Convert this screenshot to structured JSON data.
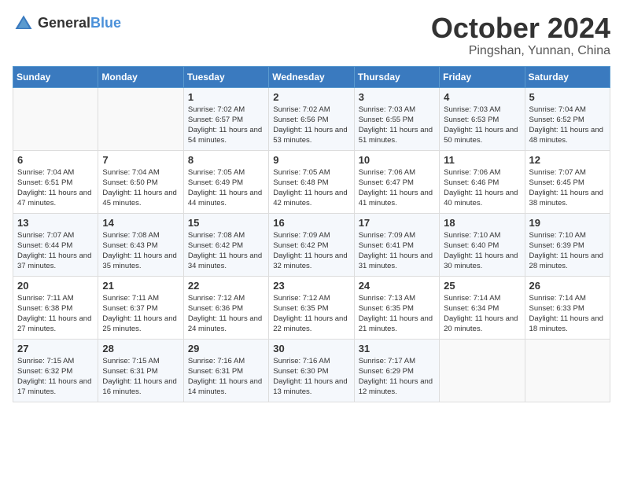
{
  "header": {
    "logo_general": "General",
    "logo_blue": "Blue",
    "month_title": "October 2024",
    "location": "Pingshan, Yunnan, China"
  },
  "weekdays": [
    "Sunday",
    "Monday",
    "Tuesday",
    "Wednesday",
    "Thursday",
    "Friday",
    "Saturday"
  ],
  "weeks": [
    [
      {
        "day": "",
        "sunrise": "",
        "sunset": "",
        "daylight": ""
      },
      {
        "day": "",
        "sunrise": "",
        "sunset": "",
        "daylight": ""
      },
      {
        "day": "1",
        "sunrise": "Sunrise: 7:02 AM",
        "sunset": "Sunset: 6:57 PM",
        "daylight": "Daylight: 11 hours and 54 minutes."
      },
      {
        "day": "2",
        "sunrise": "Sunrise: 7:02 AM",
        "sunset": "Sunset: 6:56 PM",
        "daylight": "Daylight: 11 hours and 53 minutes."
      },
      {
        "day": "3",
        "sunrise": "Sunrise: 7:03 AM",
        "sunset": "Sunset: 6:55 PM",
        "daylight": "Daylight: 11 hours and 51 minutes."
      },
      {
        "day": "4",
        "sunrise": "Sunrise: 7:03 AM",
        "sunset": "Sunset: 6:53 PM",
        "daylight": "Daylight: 11 hours and 50 minutes."
      },
      {
        "day": "5",
        "sunrise": "Sunrise: 7:04 AM",
        "sunset": "Sunset: 6:52 PM",
        "daylight": "Daylight: 11 hours and 48 minutes."
      }
    ],
    [
      {
        "day": "6",
        "sunrise": "Sunrise: 7:04 AM",
        "sunset": "Sunset: 6:51 PM",
        "daylight": "Daylight: 11 hours and 47 minutes."
      },
      {
        "day": "7",
        "sunrise": "Sunrise: 7:04 AM",
        "sunset": "Sunset: 6:50 PM",
        "daylight": "Daylight: 11 hours and 45 minutes."
      },
      {
        "day": "8",
        "sunrise": "Sunrise: 7:05 AM",
        "sunset": "Sunset: 6:49 PM",
        "daylight": "Daylight: 11 hours and 44 minutes."
      },
      {
        "day": "9",
        "sunrise": "Sunrise: 7:05 AM",
        "sunset": "Sunset: 6:48 PM",
        "daylight": "Daylight: 11 hours and 42 minutes."
      },
      {
        "day": "10",
        "sunrise": "Sunrise: 7:06 AM",
        "sunset": "Sunset: 6:47 PM",
        "daylight": "Daylight: 11 hours and 41 minutes."
      },
      {
        "day": "11",
        "sunrise": "Sunrise: 7:06 AM",
        "sunset": "Sunset: 6:46 PM",
        "daylight": "Daylight: 11 hours and 40 minutes."
      },
      {
        "day": "12",
        "sunrise": "Sunrise: 7:07 AM",
        "sunset": "Sunset: 6:45 PM",
        "daylight": "Daylight: 11 hours and 38 minutes."
      }
    ],
    [
      {
        "day": "13",
        "sunrise": "Sunrise: 7:07 AM",
        "sunset": "Sunset: 6:44 PM",
        "daylight": "Daylight: 11 hours and 37 minutes."
      },
      {
        "day": "14",
        "sunrise": "Sunrise: 7:08 AM",
        "sunset": "Sunset: 6:43 PM",
        "daylight": "Daylight: 11 hours and 35 minutes."
      },
      {
        "day": "15",
        "sunrise": "Sunrise: 7:08 AM",
        "sunset": "Sunset: 6:42 PM",
        "daylight": "Daylight: 11 hours and 34 minutes."
      },
      {
        "day": "16",
        "sunrise": "Sunrise: 7:09 AM",
        "sunset": "Sunset: 6:42 PM",
        "daylight": "Daylight: 11 hours and 32 minutes."
      },
      {
        "day": "17",
        "sunrise": "Sunrise: 7:09 AM",
        "sunset": "Sunset: 6:41 PM",
        "daylight": "Daylight: 11 hours and 31 minutes."
      },
      {
        "day": "18",
        "sunrise": "Sunrise: 7:10 AM",
        "sunset": "Sunset: 6:40 PM",
        "daylight": "Daylight: 11 hours and 30 minutes."
      },
      {
        "day": "19",
        "sunrise": "Sunrise: 7:10 AM",
        "sunset": "Sunset: 6:39 PM",
        "daylight": "Daylight: 11 hours and 28 minutes."
      }
    ],
    [
      {
        "day": "20",
        "sunrise": "Sunrise: 7:11 AM",
        "sunset": "Sunset: 6:38 PM",
        "daylight": "Daylight: 11 hours and 27 minutes."
      },
      {
        "day": "21",
        "sunrise": "Sunrise: 7:11 AM",
        "sunset": "Sunset: 6:37 PM",
        "daylight": "Daylight: 11 hours and 25 minutes."
      },
      {
        "day": "22",
        "sunrise": "Sunrise: 7:12 AM",
        "sunset": "Sunset: 6:36 PM",
        "daylight": "Daylight: 11 hours and 24 minutes."
      },
      {
        "day": "23",
        "sunrise": "Sunrise: 7:12 AM",
        "sunset": "Sunset: 6:35 PM",
        "daylight": "Daylight: 11 hours and 22 minutes."
      },
      {
        "day": "24",
        "sunrise": "Sunrise: 7:13 AM",
        "sunset": "Sunset: 6:35 PM",
        "daylight": "Daylight: 11 hours and 21 minutes."
      },
      {
        "day": "25",
        "sunrise": "Sunrise: 7:14 AM",
        "sunset": "Sunset: 6:34 PM",
        "daylight": "Daylight: 11 hours and 20 minutes."
      },
      {
        "day": "26",
        "sunrise": "Sunrise: 7:14 AM",
        "sunset": "Sunset: 6:33 PM",
        "daylight": "Daylight: 11 hours and 18 minutes."
      }
    ],
    [
      {
        "day": "27",
        "sunrise": "Sunrise: 7:15 AM",
        "sunset": "Sunset: 6:32 PM",
        "daylight": "Daylight: 11 hours and 17 minutes."
      },
      {
        "day": "28",
        "sunrise": "Sunrise: 7:15 AM",
        "sunset": "Sunset: 6:31 PM",
        "daylight": "Daylight: 11 hours and 16 minutes."
      },
      {
        "day": "29",
        "sunrise": "Sunrise: 7:16 AM",
        "sunset": "Sunset: 6:31 PM",
        "daylight": "Daylight: 11 hours and 14 minutes."
      },
      {
        "day": "30",
        "sunrise": "Sunrise: 7:16 AM",
        "sunset": "Sunset: 6:30 PM",
        "daylight": "Daylight: 11 hours and 13 minutes."
      },
      {
        "day": "31",
        "sunrise": "Sunrise: 7:17 AM",
        "sunset": "Sunset: 6:29 PM",
        "daylight": "Daylight: 11 hours and 12 minutes."
      },
      {
        "day": "",
        "sunrise": "",
        "sunset": "",
        "daylight": ""
      },
      {
        "day": "",
        "sunrise": "",
        "sunset": "",
        "daylight": ""
      }
    ]
  ]
}
